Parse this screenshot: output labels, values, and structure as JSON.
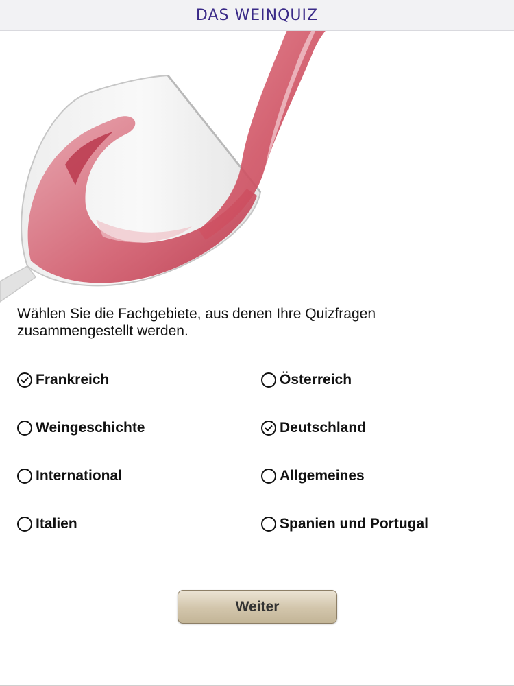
{
  "header": {
    "title": "DAS WEINQUIZ"
  },
  "hero": {
    "image": "red-wine-pouring-into-glass",
    "wine_color": "#c23a4e"
  },
  "instruction": "Wählen Sie die Fachgebiete, aus denen Ihre Quizfragen zusammengestellt werden.",
  "topics": [
    {
      "label": "Frankreich",
      "checked": true
    },
    {
      "label": "Österreich",
      "checked": false
    },
    {
      "label": "Weingeschichte",
      "checked": false
    },
    {
      "label": "Deutschland",
      "checked": true
    },
    {
      "label": "International",
      "checked": false
    },
    {
      "label": "Allgemeines",
      "checked": false
    },
    {
      "label": "Italien",
      "checked": false
    },
    {
      "label": "Spanien und Portugal",
      "checked": false
    }
  ],
  "next_button": {
    "label": "Weiter"
  },
  "colors": {
    "title": "#3a2a88",
    "button": "#d2c5ab"
  }
}
